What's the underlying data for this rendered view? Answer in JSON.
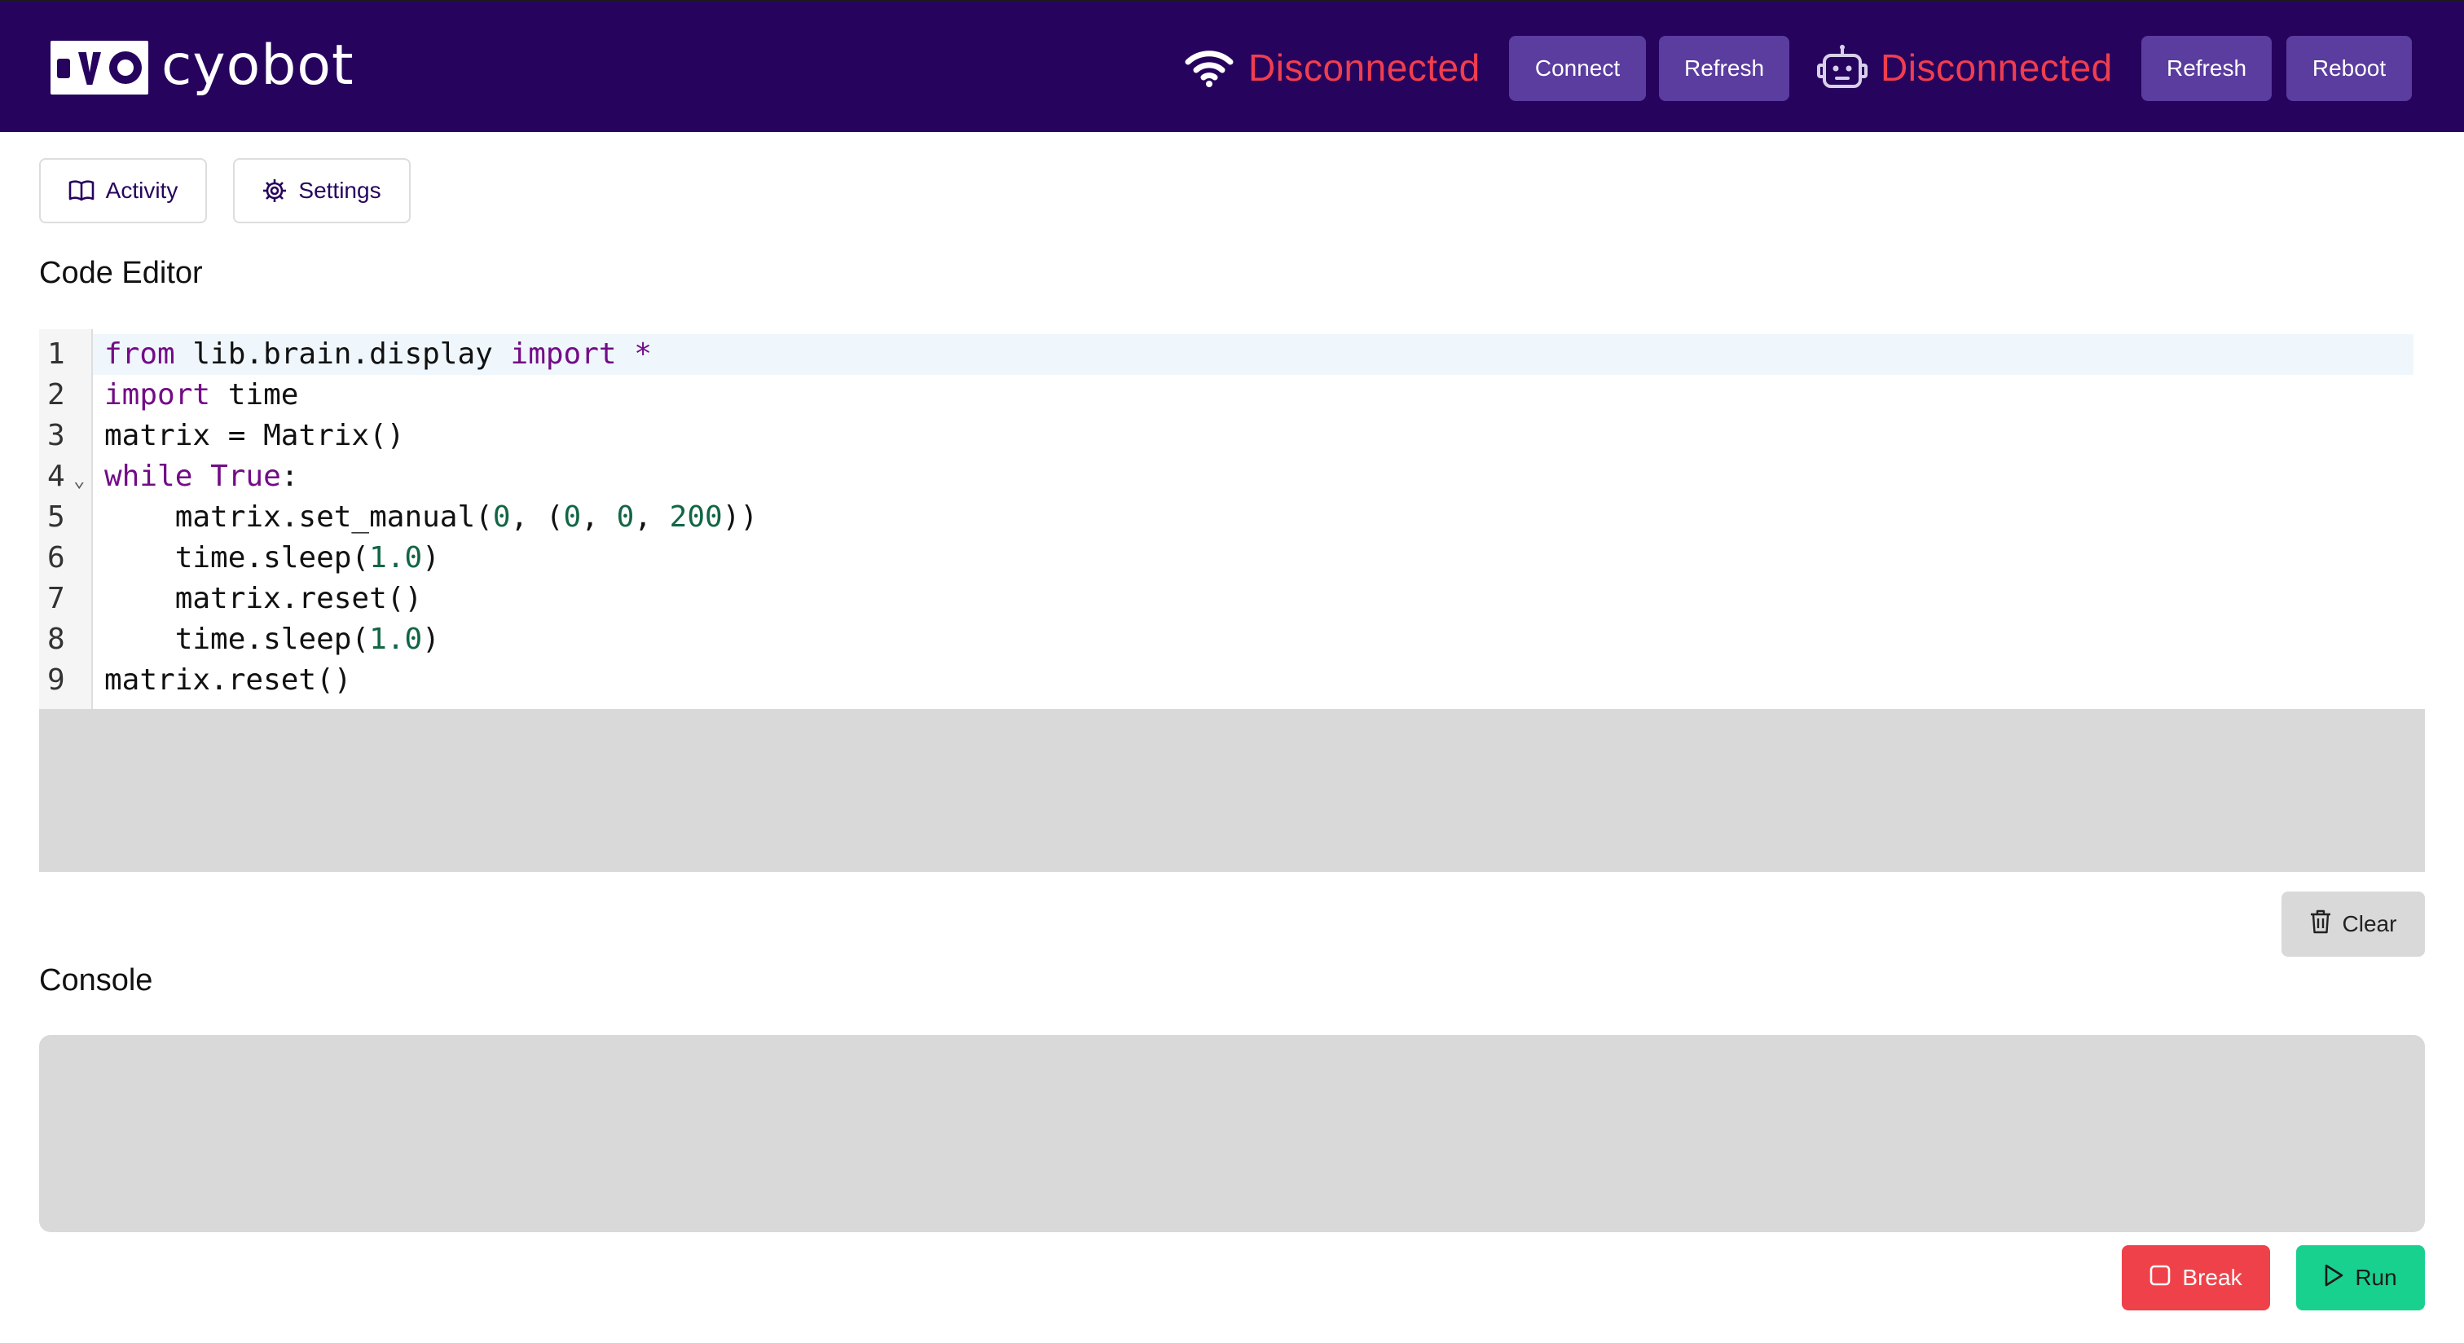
{
  "header": {
    "brand": "cyobot",
    "wifi_status": "Disconnected",
    "connect_label": "Connect",
    "refresh_label_1": "Refresh",
    "robot_status": "Disconnected",
    "refresh_label_2": "Refresh",
    "reboot_label": "Reboot"
  },
  "tabs": {
    "activity_label": "Activity",
    "settings_label": "Settings"
  },
  "editor": {
    "title": "Code Editor",
    "line_numbers": [
      "1",
      "2",
      "3",
      "4",
      "5",
      "6",
      "7",
      "8",
      "9"
    ],
    "active_line": 1,
    "lines": [
      "from lib.brain.display import *",
      "import time",
      "matrix = Matrix()",
      "while True:",
      "    matrix.set_manual(0, (0, 0, 200))",
      "    time.sleep(1.0)",
      "    matrix.reset()",
      "    time.sleep(1.0)",
      "matrix.reset()"
    ]
  },
  "console": {
    "title": "Console",
    "clear_label": "Clear",
    "break_label": "Break",
    "run_label": "Run"
  },
  "icons": {
    "wifi": "wifi-icon",
    "robot": "robot-icon",
    "activity": "book-icon",
    "settings": "gear-icon",
    "clear": "trash-icon",
    "break": "square-icon",
    "run": "play-icon"
  },
  "colors": {
    "header_bg": "#26045e",
    "nav_button": "#5b3c9f",
    "status_error": "#f03e4f",
    "break_button": "#ef4149",
    "run_button": "#19d18f",
    "keyword": "#730c87",
    "number": "#116644"
  }
}
